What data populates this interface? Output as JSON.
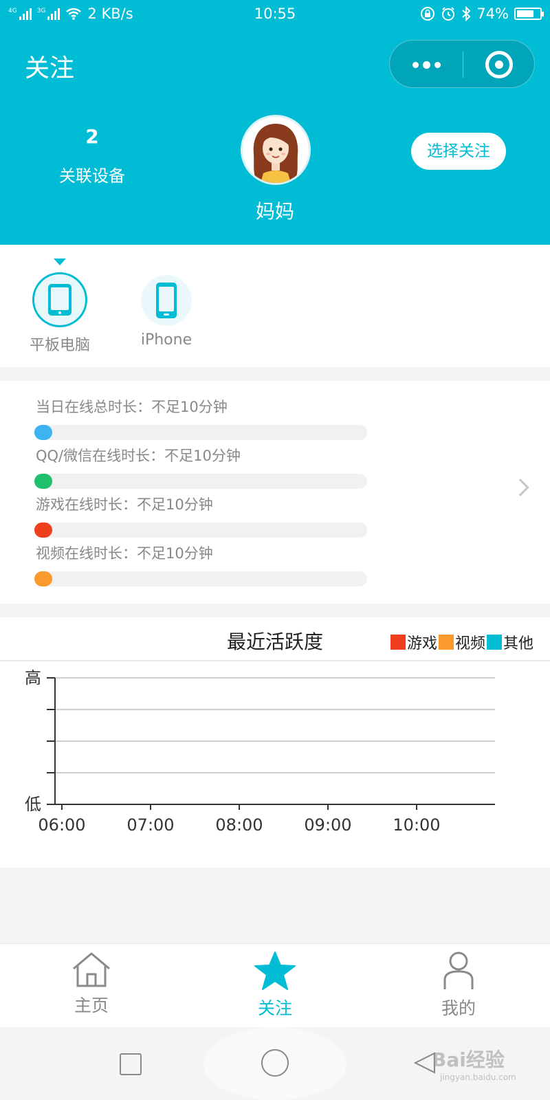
{
  "status_bar": {
    "network": [
      "4G",
      "3G"
    ],
    "speed": "2 KB/s",
    "time": "10:55",
    "battery": "74%",
    "battery_level": 0.74
  },
  "header": {
    "title": "关注",
    "device_count": "2",
    "device_count_label": "关联设备",
    "profile_name": "妈妈",
    "follow_button": "选择关注"
  },
  "devices": [
    {
      "label": "平板电脑",
      "icon": "tablet-icon",
      "selected": true
    },
    {
      "label": "iPhone",
      "icon": "phone-icon",
      "selected": false
    }
  ],
  "stats": [
    {
      "label": "当日在线总时长：不足10分钟",
      "color": "#3db4f2",
      "progress": 0
    },
    {
      "label": "QQ/微信在线时长：不足10分钟",
      "color": "#1fbf6b",
      "progress": 0
    },
    {
      "label": "游戏在线时长：不足10分钟",
      "color": "#ef3f1c",
      "progress": 0
    },
    {
      "label": "视频在线时长：不足10分钟",
      "color": "#fb9a2c",
      "progress": 0
    }
  ],
  "activity": {
    "title": "最近活跃度",
    "legend": [
      {
        "name": "游戏",
        "color": "#ef3f1c"
      },
      {
        "name": "视频",
        "color": "#fb9a2c"
      },
      {
        "name": "其他",
        "color": "#00bcd4"
      }
    ]
  },
  "chart_data": {
    "type": "bar",
    "categories": [
      "06:00",
      "07:00",
      "08:00",
      "09:00",
      "10:00"
    ],
    "series": [
      {
        "name": "游戏",
        "values": [
          0,
          0,
          0,
          0,
          0
        ]
      },
      {
        "name": "视频",
        "values": [
          0,
          0,
          0,
          0,
          0
        ]
      },
      {
        "name": "其他",
        "values": [
          0,
          0,
          0,
          0,
          0
        ]
      }
    ],
    "y_tick_labels": [
      "低",
      "高"
    ],
    "ylim": [
      0,
      4
    ],
    "grid": true
  },
  "tabbar": [
    {
      "label": "主页",
      "icon": "home-icon",
      "active": false
    },
    {
      "label": "关注",
      "icon": "star-icon",
      "active": true
    },
    {
      "label": "我的",
      "icon": "person-icon",
      "active": false
    }
  ],
  "watermark": {
    "text": "Bai经验",
    "sub": "jingyan.baidu.com"
  }
}
